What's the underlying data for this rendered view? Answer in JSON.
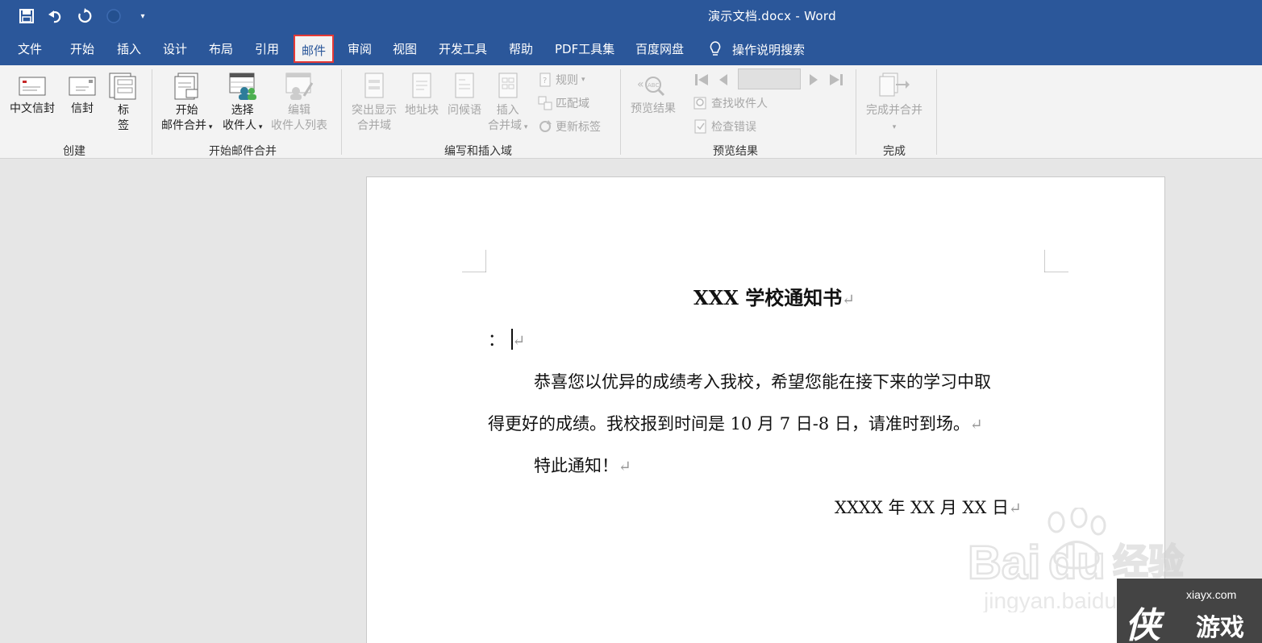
{
  "title_bar": {
    "document_title": "演示文档.docx  -  Word",
    "quick_access": [
      "save-icon",
      "undo-icon",
      "redo-icon",
      "touch-mode-icon",
      "customize-qat-icon"
    ]
  },
  "tabs": {
    "items": [
      "文件",
      "开始",
      "插入",
      "设计",
      "布局",
      "引用",
      "邮件",
      "审阅",
      "视图",
      "开发工具",
      "帮助",
      "PDF工具集",
      "百度网盘"
    ],
    "active": "邮件",
    "tell_me": "操作说明搜索"
  },
  "ribbon": {
    "create": {
      "label": "创建",
      "envelope_cn": "中文信封",
      "envelope": "信封",
      "labels_l1": "标",
      "labels_l2": "签"
    },
    "start_merge": {
      "label": "开始邮件合并",
      "start_l1": "开始",
      "start_l2": "邮件合并",
      "select_l1": "选择",
      "select_l2": "收件人",
      "edit_l1": "编辑",
      "edit_l2": "收件人列表"
    },
    "write_insert": {
      "label": "编写和插入域",
      "highlight_l1": "突出显示",
      "highlight_l2": "合并域",
      "address_block": "地址块",
      "greeting": "问候语",
      "insert_l1": "插入",
      "insert_l2": "合并域",
      "rules": "规则",
      "match_fields": "匹配域",
      "update_labels": "更新标签"
    },
    "preview": {
      "label": "预览结果",
      "preview_results": "预览结果",
      "find_recipient": "查找收件人",
      "check_errors": "检查错误",
      "record_value": ""
    },
    "finish": {
      "label": "完成",
      "finish_merge": "完成并合并"
    }
  },
  "document": {
    "title": "XXX 学校通知书",
    "salutation": "：",
    "para1_line1": "恭喜您以优异的成绩考入我校，希望您能在接下来的学习中取",
    "para1_line2": "得更好的成绩。我校报到时间是 10 月 7 日-8 日，请准时到场。",
    "para2": "特此通知！",
    "date": "XXXX 年 XX 月 XX 日",
    "paragraph_mark": "↵"
  },
  "watermarks": {
    "baidu": "Baidu经验",
    "baidu_url": "jingyan.baidu.com",
    "corner_site": "xiayx.com",
    "corner_logo": "侠",
    "corner_text": "游戏"
  },
  "colors": {
    "title_bar": "#2b579a",
    "ribbon_bg": "#f3f3f3",
    "active_tab_outline": "#e53935",
    "disabled_text": "#a6a6a6"
  }
}
